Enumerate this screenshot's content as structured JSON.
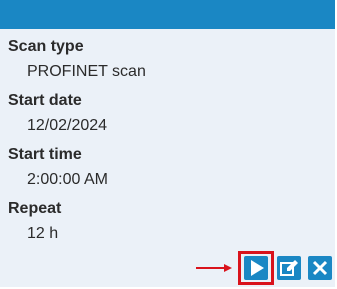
{
  "details": {
    "scan_type": {
      "label": "Scan type",
      "value": "PROFINET scan"
    },
    "start_date": {
      "label": "Start date",
      "value": "12/02/2024"
    },
    "start_time": {
      "label": "Start time",
      "value": "2:00:00 AM"
    },
    "repeat": {
      "label": "Repeat",
      "value": "12 h"
    }
  },
  "actions": {
    "start": {
      "icon": "play-icon"
    },
    "edit": {
      "icon": "edit-icon"
    },
    "delete": {
      "icon": "close-icon"
    }
  },
  "annotation": {
    "arrow_icon": "arrow-right-icon"
  },
  "colors": {
    "header": "#1a87c4",
    "panel_background": "#ebf1f8",
    "button": "#1a87c4",
    "annotation": "#d9131c",
    "text": "#2b2b2b"
  }
}
